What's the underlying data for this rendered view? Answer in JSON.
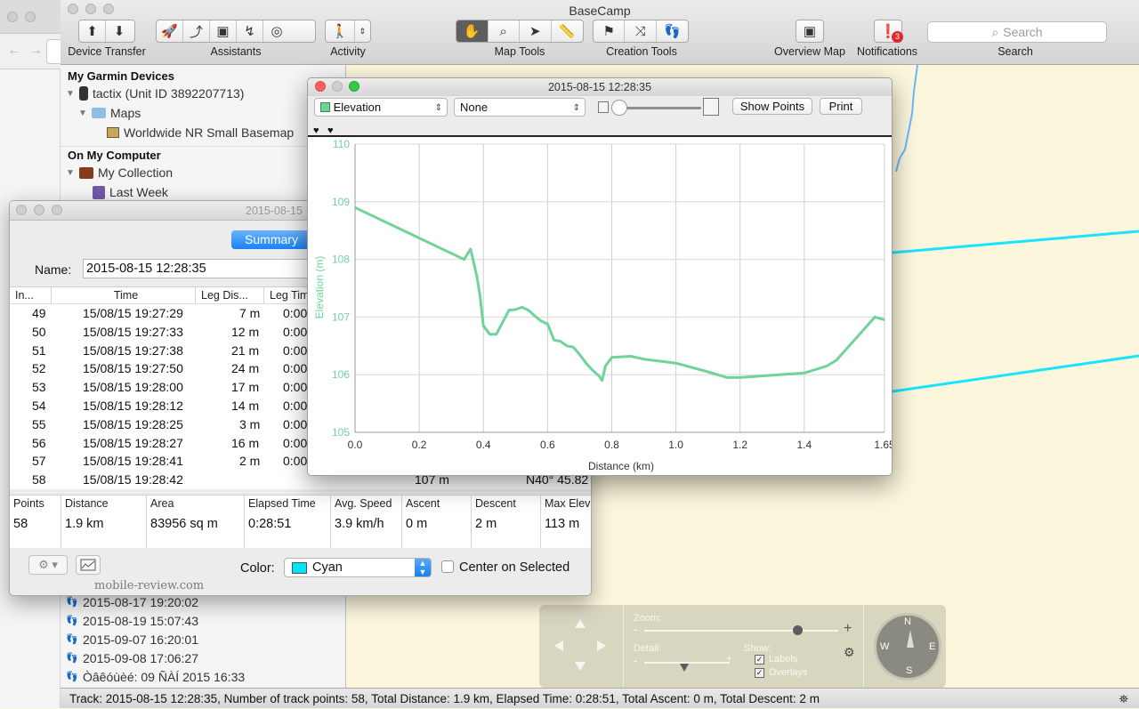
{
  "app": {
    "title": "BaseCamp"
  },
  "toolbar": {
    "device_transfer": "Device Transfer",
    "assistants": "Assistants",
    "activity": "Activity",
    "map_tools": "Map Tools",
    "creation_tools": "Creation Tools",
    "overview_map": "Overview Map",
    "notifications": "Notifications",
    "notifications_badge": "3",
    "search_placeholder": "Search",
    "search_label": "Search"
  },
  "sidebar": {
    "devices_header": "My Garmin Devices",
    "device": "tactix (Unit ID 3892207713)",
    "maps": "Maps",
    "basemap": "Worldwide NR Small Basemap",
    "computer_header": "On My Computer",
    "collection": "My Collection",
    "last_week": "Last Week",
    "tracks": [
      "2015-08-17 19:20:02",
      "2015-08-19 15:07:43",
      "2015-09-07 16:20:01",
      "2015-09-08 17:06:27",
      "Òâêóùèé: 09 ÑÀÍ 2015 16:33"
    ]
  },
  "track_window": {
    "title": "2015-08-15",
    "tab": "Summary",
    "name_label": "Name:",
    "name_value": "2015-08-15 12:28:35",
    "columns": [
      "In...",
      "Time",
      "Leg Dis...",
      "Leg Tim"
    ],
    "rows": [
      {
        "index": "49",
        "time": "15/08/15 19:27:29",
        "dist": "7 m",
        "legtime": "0:00"
      },
      {
        "index": "50",
        "time": "15/08/15 19:27:33",
        "dist": "12 m",
        "legtime": "0:00"
      },
      {
        "index": "51",
        "time": "15/08/15 19:27:38",
        "dist": "21 m",
        "legtime": "0:00"
      },
      {
        "index": "52",
        "time": "15/08/15 19:27:50",
        "dist": "24 m",
        "legtime": "0:00"
      },
      {
        "index": "53",
        "time": "15/08/15 19:28:00",
        "dist": "17 m",
        "legtime": "0:00"
      },
      {
        "index": "54",
        "time": "15/08/15 19:28:12",
        "dist": "14 m",
        "legtime": "0:00"
      },
      {
        "index": "55",
        "time": "15/08/15 19:28:25",
        "dist": "3 m",
        "legtime": "0:00"
      },
      {
        "index": "56",
        "time": "15/08/15 19:28:27",
        "dist": "16 m",
        "legtime": "0:00"
      },
      {
        "index": "57",
        "time": "15/08/15 19:28:41",
        "dist": "2 m",
        "legtime": "0:00"
      },
      {
        "index": "58",
        "time": "15/08/15 19:28:42",
        "dist": "",
        "legtime": ""
      }
    ],
    "row_58_extra": {
      "elevation": "107 m",
      "position": "N40° 45.82"
    },
    "stats_headers": [
      "Points",
      "Distance",
      "Area",
      "Elapsed Time",
      "Avg. Speed",
      "Ascent",
      "Descent",
      "Max Elev"
    ],
    "stats_values": [
      "58",
      "1.9 km",
      "83956 sq m",
      "0:28:51",
      "3.9 km/h",
      "0 m",
      "2 m",
      "113 m"
    ],
    "color_label": "Color:",
    "color_value": "Cyan",
    "color_hex": "#00e5ff",
    "center_label": "Center on Selected",
    "watermark": "mobile-review.com"
  },
  "elevation_window": {
    "title": "2015-08-15 12:28:35",
    "profile_select": "Elevation",
    "second_select": "None",
    "show_points": "Show Points",
    "print": "Print"
  },
  "chart_data": {
    "type": "line",
    "xlabel": "Distance (km)",
    "ylabel": "Elevation (m)",
    "x_ticks": [
      "0.0",
      "0.2",
      "0.4",
      "0.6",
      "0.8",
      "1.0",
      "1.2",
      "1.4",
      "1.65"
    ],
    "y_ticks": [
      "105",
      "106",
      "107",
      "108",
      "109",
      "110"
    ],
    "xlim": [
      0,
      1.65
    ],
    "ylim": [
      105,
      110
    ],
    "color": "#6fd39a",
    "series": [
      {
        "x": [
          0.0,
          0.34,
          0.36,
          0.38,
          0.39,
          0.4,
          0.42,
          0.44,
          0.48,
          0.5,
          0.52,
          0.54,
          0.56,
          0.58,
          0.6,
          0.62,
          0.64,
          0.66,
          0.68,
          0.7,
          0.72,
          0.74,
          0.76,
          0.77,
          0.78,
          0.8,
          0.86,
          0.9,
          1.0,
          1.1,
          1.16,
          1.2,
          1.4,
          1.47,
          1.5,
          1.54,
          1.58,
          1.62,
          1.65
        ],
        "y": [
          108.9,
          108.0,
          108.18,
          107.7,
          107.35,
          106.85,
          106.7,
          106.7,
          107.12,
          107.13,
          107.17,
          107.12,
          107.02,
          106.93,
          106.88,
          106.6,
          106.58,
          106.5,
          106.48,
          106.35,
          106.2,
          106.08,
          105.98,
          105.9,
          106.15,
          106.3,
          106.32,
          106.27,
          106.2,
          106.05,
          105.95,
          105.95,
          106.03,
          106.15,
          106.25,
          106.5,
          106.75,
          107.0,
          106.95
        ]
      }
    ]
  },
  "map_controls": {
    "zoom": "Zoom:",
    "detail": "Detail:",
    "show": "Show:",
    "labels": "Labels",
    "overlays": "Overlays",
    "compass": {
      "n": "N",
      "s": "S",
      "e": "E",
      "w": "W"
    },
    "plus": "+",
    "minus": "-"
  },
  "statusbar": {
    "text": "Track: 2015-08-15 12:28:35, Number of track points: 58, Total Distance: 1.9 km, Elapsed Time: 0:28:51, Total Ascent: 0 m, Total Descent: 2 m"
  }
}
